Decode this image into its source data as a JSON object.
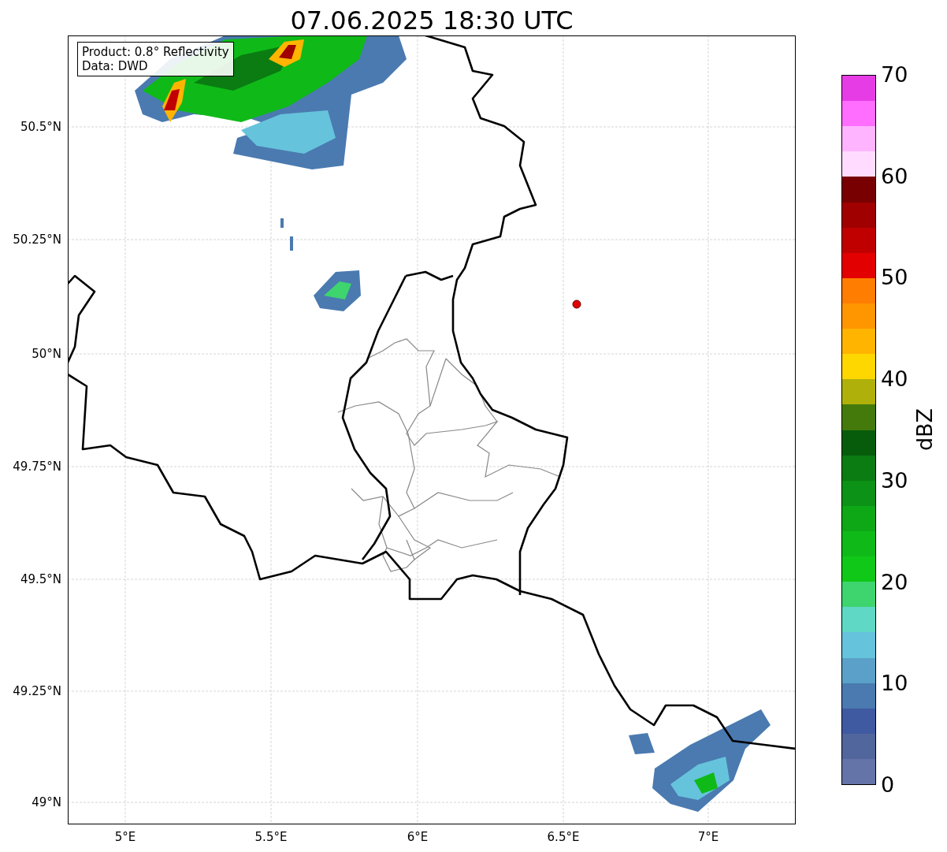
{
  "title": "07.06.2025 18:30 UTC",
  "map": {
    "legend": [
      "Product: 0.8° Reflectivity",
      "Data: DWD"
    ],
    "y_ticks": [
      "50.5°N",
      "50.25°N",
      "50°N",
      "49.75°N",
      "49.5°N",
      "49.25°N",
      "49°N"
    ],
    "x_ticks": [
      "5°E",
      "5.5°E",
      "6°E",
      "6.5°E",
      "7°E"
    ]
  },
  "colorbar": {
    "label": "dBZ",
    "ticks": [
      "70",
      "60",
      "50",
      "40",
      "30",
      "20",
      "10",
      "0"
    ],
    "bins": [
      {
        "color": "#e63ce6"
      },
      {
        "color": "#ff6eff"
      },
      {
        "color": "#ffb4ff"
      },
      {
        "color": "#ffdcff"
      },
      {
        "color": "#780000"
      },
      {
        "color": "#a00000"
      },
      {
        "color": "#c00000"
      },
      {
        "color": "#e20000"
      },
      {
        "color": "#ff7d00"
      },
      {
        "color": "#ff9600"
      },
      {
        "color": "#ffb400"
      },
      {
        "color": "#ffd700"
      },
      {
        "color": "#b0b00a"
      },
      {
        "color": "#447a0c"
      },
      {
        "color": "#075c0c"
      },
      {
        "color": "#0a7c12"
      },
      {
        "color": "#0c9216"
      },
      {
        "color": "#0ea817"
      },
      {
        "color": "#0fba18"
      },
      {
        "color": "#10c818"
      },
      {
        "color": "#3ed46e"
      },
      {
        "color": "#60d8c6"
      },
      {
        "color": "#66c3dc"
      },
      {
        "color": "#5aa0c8"
      },
      {
        "color": "#4a7ab0"
      },
      {
        "color": "#3f5aa0"
      },
      {
        "color": "#52669e"
      },
      {
        "color": "#6473a8"
      }
    ]
  }
}
